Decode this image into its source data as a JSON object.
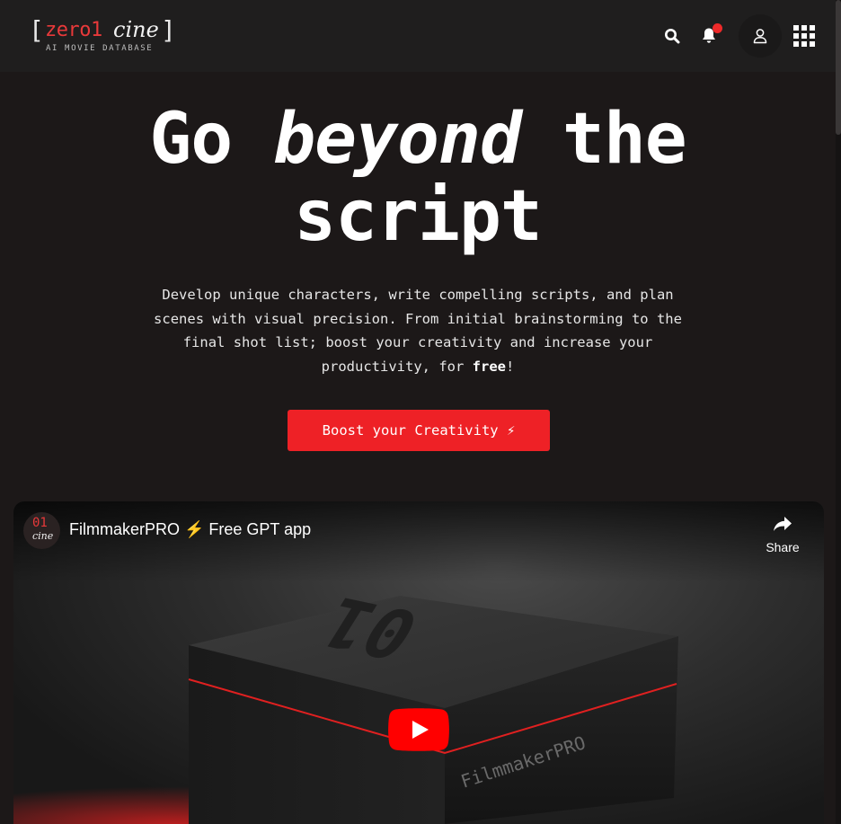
{
  "header": {
    "logo": {
      "bracket_open": "[",
      "zero": "zero1",
      "cine": "cine",
      "bracket_close": "]",
      "tagline": "AI MOVIE DATABASE"
    },
    "icons": {
      "search": "search-icon",
      "notifications": "bell-icon",
      "user": "user-icon",
      "apps": "grid-icon"
    },
    "notification_dot_color": "#ee2a2a"
  },
  "hero": {
    "title_part1": "Go ",
    "title_emphasis": "beyond",
    "title_part2": " the",
    "title_line2": "script",
    "description_main": "Develop unique characters, write compelling scripts, and plan scenes with visual precision. From initial brainstorming to the final shot list; boost your creativity and increase your productivity, for ",
    "description_bold": "free",
    "description_end": "!",
    "cta_label": "Boost your Creativity ⚡"
  },
  "video": {
    "channel_avatar_top": "01",
    "channel_avatar_bottom": "cine",
    "title": "FilmmakerPRO ⚡ Free GPT app",
    "share_label": "Share",
    "box_front_text": "FilmmakerPRO",
    "box_top_text": "01"
  },
  "colors": {
    "accent": "#ee2126",
    "background": "#1c1818",
    "header_background": "#1f1e1e"
  }
}
